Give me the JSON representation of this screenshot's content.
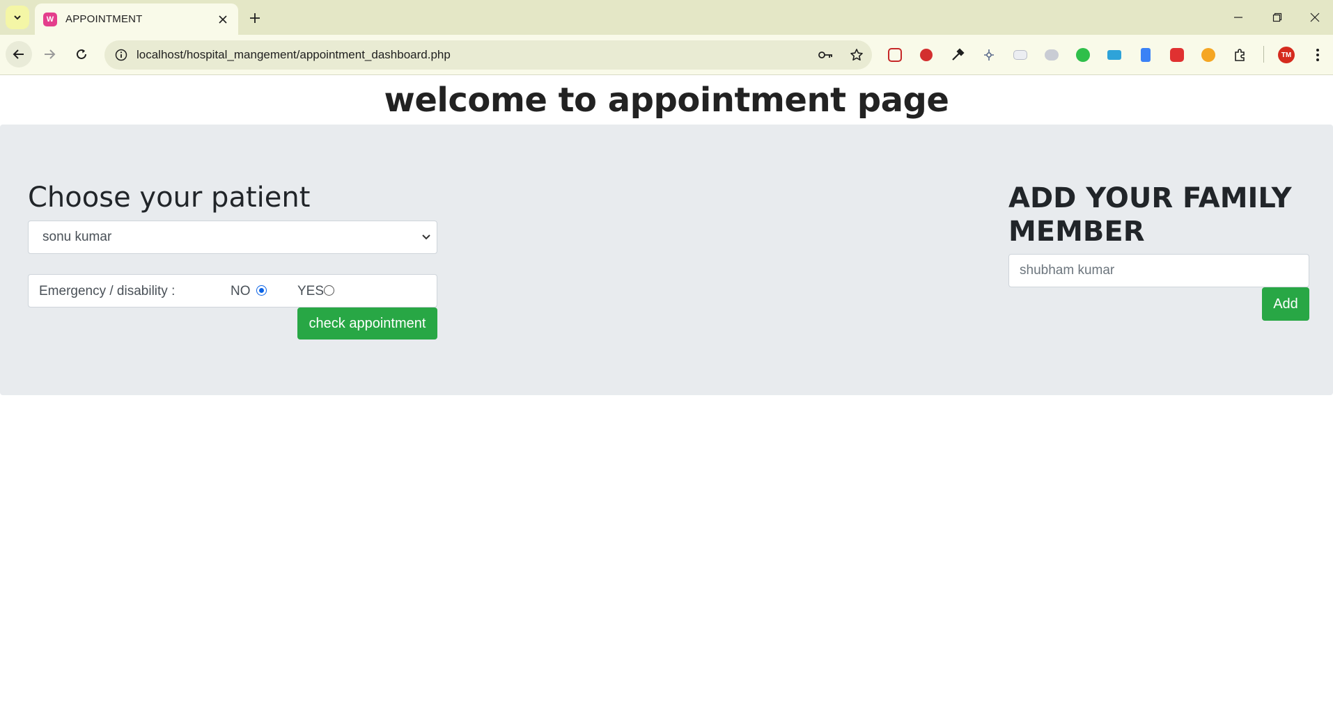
{
  "browser": {
    "tab_title": "APPOINTMENT",
    "url": "localhost/hospital_mangement/appointment_dashboard.php",
    "icons": [
      "tab-search-icon",
      "close-icon",
      "new-tab-icon",
      "minimize-icon",
      "restore-icon",
      "window-close-icon",
      "back-icon",
      "forward-icon",
      "reload-icon",
      "site-info-icon",
      "key-icon",
      "star-icon",
      "extensions-icon",
      "menu-icon"
    ],
    "profile_initials": "TM"
  },
  "page": {
    "heading": "welcome to appointment page",
    "left": {
      "title": "Choose your patient",
      "selected_patient": "sonu kumar",
      "emergency_label": "Emergency / disability :",
      "option_no": "NO",
      "option_yes": "YES",
      "selected_option": "NO",
      "check_button": "check appointment"
    },
    "right": {
      "title": "ADD YOUR FAMILY MEMBER",
      "input_placeholder": "shubham kumar",
      "add_button": "Add"
    },
    "colors": {
      "panel_bg": "#e8ebee",
      "button_green": "#28a745",
      "radio_blue": "#0b63e5"
    }
  }
}
